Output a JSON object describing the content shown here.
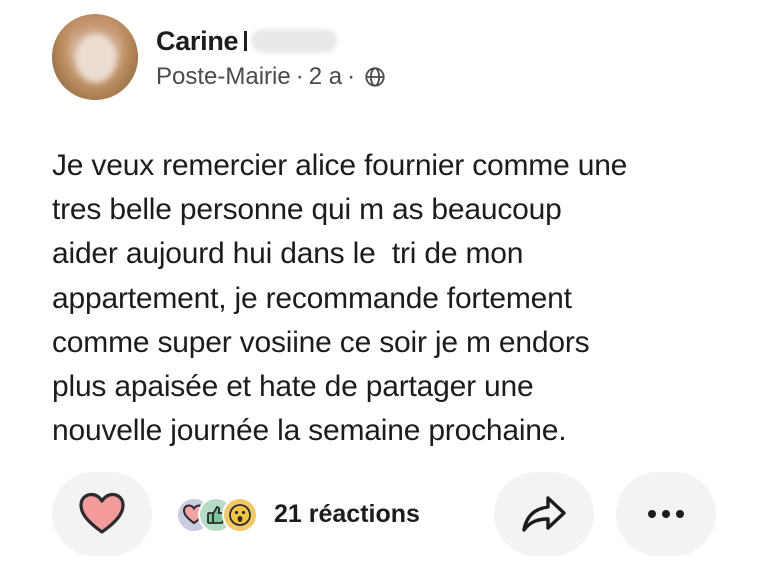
{
  "post": {
    "author": {
      "first_name": "Carine",
      "avatar_icon": "profile-photo-avatar"
    },
    "meta": {
      "location": "Poste-Mairie",
      "separator": "·",
      "age": "2 a",
      "visibility_icon": "globe-icon"
    },
    "body_lines": [
      "Je veux remercier alice fournier comme une",
      "tres belle personne qui m as beaucoup",
      "aider aujourd hui dans le  tri de mon",
      "appartement, je recommande fortement",
      "comme super vosiine ce soir je m endors",
      "plus apaisée et hate de partager une",
      "nouvelle journée la semaine prochaine."
    ],
    "footer": {
      "like_icon": "heart-icon",
      "reaction_icons": [
        "heart-reaction-icon",
        "thanks-reaction-icon",
        "wow-reaction-icon"
      ],
      "reactions_label": "21 réactions",
      "share_icon": "share-arrow-icon",
      "more_icon": "more-options-icon"
    }
  },
  "colors": {
    "text": "#1c1c1e",
    "meta_text": "#4a4a4f",
    "pill_background": "#f3f3f5",
    "heart_fill": "#f39a9a",
    "heart_outline": "#2a2a2e"
  }
}
